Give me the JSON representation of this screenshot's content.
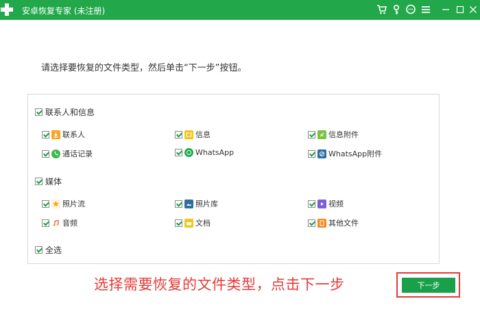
{
  "window": {
    "title": "安卓恢复专家 (未注册)",
    "icons": [
      "cart-icon",
      "key-icon",
      "chat-icon",
      "menu-icon",
      "minimize-icon",
      "maximize-icon",
      "close-icon"
    ]
  },
  "instruction": "请选择要恢复的文件类型，然后单击“下一步”按钮。",
  "groups": {
    "contacts": {
      "label": "联系人和信息",
      "items": {
        "contacts": "联系人",
        "messages": "信息",
        "message_attachments": "信息附件",
        "call_logs": "通话记录",
        "whatsapp": "WhatsApp",
        "whatsapp_attachments": "WhatsApp附件"
      }
    },
    "media": {
      "label": "媒体",
      "items": {
        "photo_stream": "照片流",
        "photo_library": "照片库",
        "video": "视频",
        "audio": "音频",
        "documents": "文档",
        "other_files": "其他文件"
      }
    },
    "select_all": "全选"
  },
  "annotation": "选择需要恢复的文件类型，点击下一步",
  "next_button": "下一步",
  "colors": {
    "titlebar": "#22a84a",
    "button": "#1aa04a",
    "annotation": "#e53935",
    "check": "#1a9e45"
  }
}
